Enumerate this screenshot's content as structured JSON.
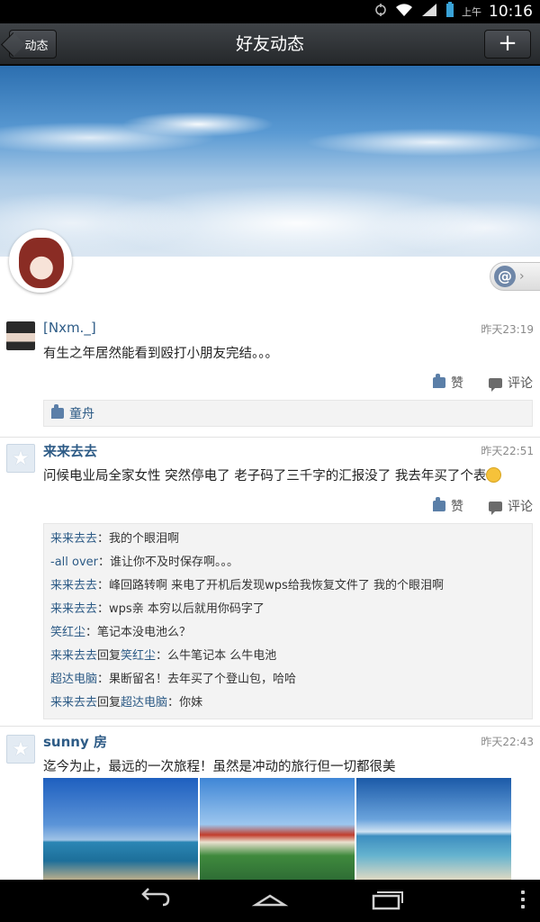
{
  "status_bar": {
    "ampm": "上午",
    "time": "10:16"
  },
  "header": {
    "back_label": "动态",
    "title": "好友动态",
    "add_label": "+"
  },
  "at_button": {
    "label": "@"
  },
  "posts": [
    {
      "author": "[Nxm._]",
      "time": "昨天23:19",
      "text": "有生之年居然能看到殴打小朋友完结。。。",
      "like_label": "赞",
      "comment_label": "评论",
      "likers": "童舟"
    },
    {
      "author": "来来去去",
      "time": "昨天22:51",
      "text": "问候电业局全家女性 突然停电了 老子码了三千字的汇报没了 我去年买了个表",
      "like_label": "赞",
      "comment_label": "评论",
      "comments": [
        {
          "who": "来来去去",
          "sep": "：",
          "text": "我的个眼泪啊"
        },
        {
          "who": "-all over",
          "sep": "：",
          "text": "谁让你不及时保存啊。。。"
        },
        {
          "who": "来来去去",
          "sep": "：",
          "text": "峰回路转啊 来电了开机后发现wps给我恢复文件了 我的个眼泪啊"
        },
        {
          "who": "来来去去",
          "sep": "：",
          "text": "wps亲 本穷以后就用你码字了"
        },
        {
          "who": "笑红尘",
          "sep": "：",
          "text": "笔记本没电池么？"
        },
        {
          "who": "来来去去",
          "reply_word": "回复",
          "to": "笑红尘",
          "sep": "：",
          "text": "么牛笔记本 么牛电池"
        },
        {
          "who": "超达电脑",
          "sep": "：",
          "text": "果断留名！去年买了个登山包，哈哈"
        },
        {
          "who": "来来去去",
          "reply_word": "回复",
          "to": "超达电脑",
          "sep": "：",
          "text": "你妹"
        }
      ]
    },
    {
      "author": "sunny 房",
      "time": "昨天22:43",
      "text": "迄今为止，最远的一次旅程！虽然是冲动的旅行但一切都很美"
    }
  ]
}
